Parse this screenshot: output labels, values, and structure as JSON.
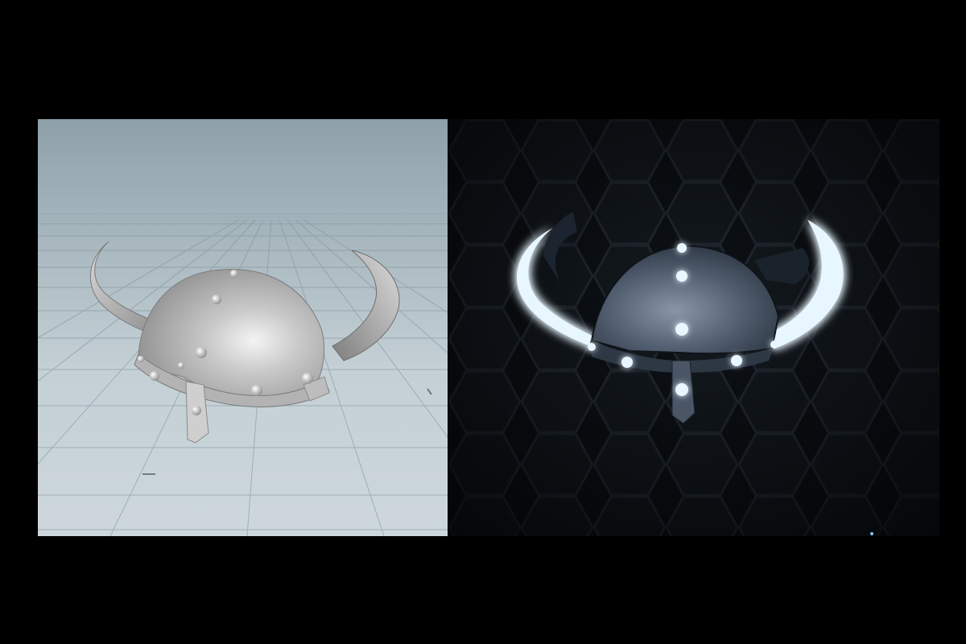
{
  "scene": {
    "background_color": "#000000",
    "panels": [
      {
        "name": "editor-viewport",
        "style": "untextured grey shaded model on reference grid",
        "sky_color": "#8ea0aa",
        "floor_color": "#cdd7dc",
        "grid_color": "#6d7f89",
        "model_color": "#c9c9c9"
      },
      {
        "name": "render-preview",
        "style": "dark hexagon backdrop with glowing blue emissive horns and rivets",
        "backdrop_color": "#0d1116",
        "hex_color": "#1b2229",
        "glow_color": "#7fc4ff",
        "core_glow_color": "#e8f6ff",
        "helmet_color": "#5a6a7c"
      }
    ],
    "model": {
      "subject": "horned helmet",
      "rivet_count_left": 9,
      "rivet_count_right": 8
    }
  }
}
